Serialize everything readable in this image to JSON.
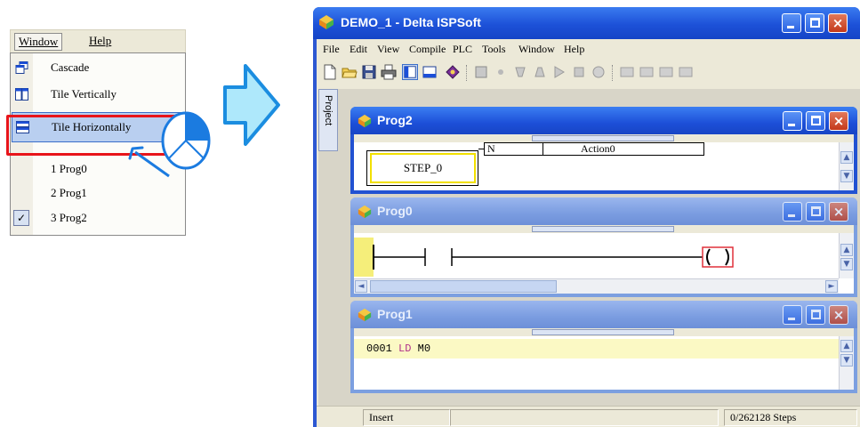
{
  "left_menu": {
    "menubar": {
      "window": "Window",
      "help": "Help"
    },
    "items": [
      {
        "label": "Cascade",
        "icon": "cascade-icon"
      },
      {
        "label": "Tile Vertically",
        "icon": "tile-vertically-icon"
      },
      {
        "label": "Tile Horizontally",
        "icon": "tile-horizontally-icon",
        "highlighted": true
      },
      {
        "label": "1 Prog0"
      },
      {
        "label": "2 Prog1"
      },
      {
        "label": "3 Prog2",
        "checked": true
      }
    ],
    "check_mark": "✓"
  },
  "app": {
    "title": "DEMO_1 - Delta ISPSoft",
    "menus": [
      "File",
      "Edit",
      "View",
      "Compile",
      "PLC",
      "Tools",
      "Window",
      "Help"
    ],
    "project_tab": "Project",
    "windows": [
      {
        "name": "Prog2",
        "state": "active",
        "step_label": "STEP_0",
        "action_qualifier": "N",
        "action_name": "Action0"
      },
      {
        "name": "Prog0",
        "state": "inactive"
      },
      {
        "name": "Prog1",
        "state": "inactive",
        "line_number": "0001",
        "instruction": "LD",
        "operand": "M0"
      }
    ],
    "status": {
      "mode": "Insert",
      "steps": "0/262128 Steps"
    }
  },
  "colors": {
    "highlight_border": "#e8141a",
    "arrow_fill": "#aee8fb",
    "arrow_stroke": "#1b8de0",
    "titlebar_active": "#1c4fd8",
    "titlebar_inactive": "#7a9ce0",
    "sfc_step_border": "#f2e000",
    "ld_rung_highlight": "#f5ee7a",
    "il_line_highlight": "#fbf9c4"
  }
}
